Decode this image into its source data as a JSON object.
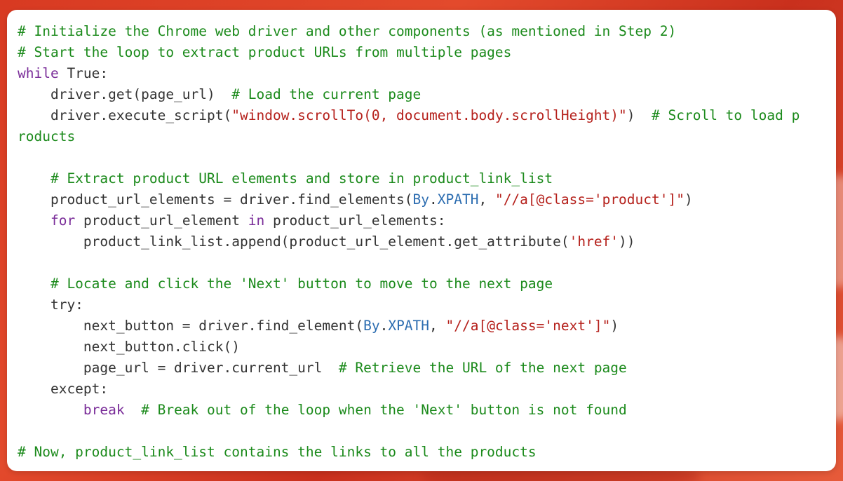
{
  "code": {
    "language": "python",
    "lines": [
      [
        {
          "t": "# Initialize the Chrome web driver and other components (as mentioned in Step 2)",
          "k": "comment"
        }
      ],
      [
        {
          "t": "# Start the loop to extract product URLs from multiple pages",
          "k": "comment"
        }
      ],
      [
        {
          "t": "while",
          "k": "kw"
        },
        {
          "t": " True:",
          "k": "plain"
        }
      ],
      [
        {
          "t": "    driver.get(page_url)  ",
          "k": "plain"
        },
        {
          "t": "# Load the current page",
          "k": "comment"
        }
      ],
      [
        {
          "t": "    driver.execute_script(",
          "k": "plain"
        },
        {
          "t": "\"window.scrollTo(0, document.body.scrollHeight)\"",
          "k": "str"
        },
        {
          "t": ")  ",
          "k": "plain"
        },
        {
          "t": "# Scroll to load p",
          "k": "comment"
        }
      ],
      [
        {
          "t": "roducts",
          "k": "comment"
        }
      ],
      [],
      [
        {
          "t": "    # Extract product URL elements and store in product_link_list",
          "k": "comment"
        }
      ],
      [
        {
          "t": "    product_url_elements = driver.find_elements(",
          "k": "plain"
        },
        {
          "t": "By",
          "k": "type"
        },
        {
          "t": ".",
          "k": "plain"
        },
        {
          "t": "XPATH",
          "k": "type"
        },
        {
          "t": ", ",
          "k": "plain"
        },
        {
          "t": "\"//a[@class='product']\"",
          "k": "str"
        },
        {
          "t": ")",
          "k": "plain"
        }
      ],
      [
        {
          "t": "    ",
          "k": "plain"
        },
        {
          "t": "for",
          "k": "kw"
        },
        {
          "t": " product_url_element ",
          "k": "plain"
        },
        {
          "t": "in",
          "k": "kw"
        },
        {
          "t": " product_url_elements:",
          "k": "plain"
        }
      ],
      [
        {
          "t": "        product_link_list.append(product_url_element.get_attribute(",
          "k": "plain"
        },
        {
          "t": "'href'",
          "k": "str"
        },
        {
          "t": "))",
          "k": "plain"
        }
      ],
      [],
      [
        {
          "t": "    # Locate and click the 'Next' button to move to the next page",
          "k": "comment"
        }
      ],
      [
        {
          "t": "    try:",
          "k": "plain"
        }
      ],
      [
        {
          "t": "        next_button = driver.find_element(",
          "k": "plain"
        },
        {
          "t": "By",
          "k": "type"
        },
        {
          "t": ".",
          "k": "plain"
        },
        {
          "t": "XPATH",
          "k": "type"
        },
        {
          "t": ", ",
          "k": "plain"
        },
        {
          "t": "\"//a[@class='next']\"",
          "k": "str"
        },
        {
          "t": ")",
          "k": "plain"
        }
      ],
      [
        {
          "t": "        next_button.click()",
          "k": "plain"
        }
      ],
      [
        {
          "t": "        page_url = driver.current_url  ",
          "k": "plain"
        },
        {
          "t": "# Retrieve the URL of the next page",
          "k": "comment"
        }
      ],
      [
        {
          "t": "    except:",
          "k": "plain"
        }
      ],
      [
        {
          "t": "        ",
          "k": "plain"
        },
        {
          "t": "break",
          "k": "kw"
        },
        {
          "t": "  ",
          "k": "plain"
        },
        {
          "t": "# Break out of the loop when the 'Next' button is not found",
          "k": "comment"
        }
      ],
      [],
      [
        {
          "t": "# Now, product_link_list contains the links to all the products",
          "k": "comment"
        }
      ]
    ]
  },
  "colors": {
    "comment": "#1b8a1b",
    "keyword": "#7a2d99",
    "string": "#b5201b",
    "type": "#2b6cb0",
    "plain": "#333333",
    "background": "#d83a22",
    "card": "#ffffff"
  }
}
